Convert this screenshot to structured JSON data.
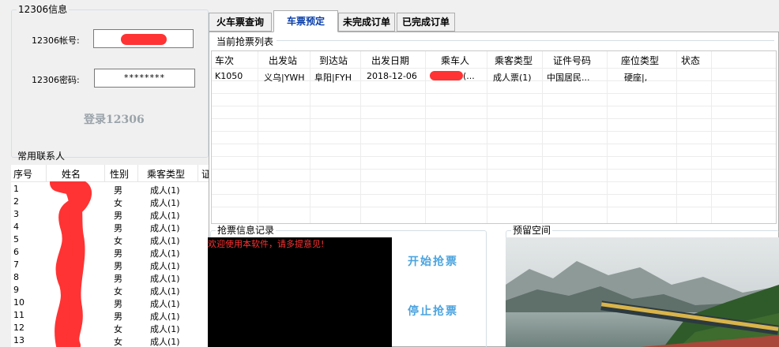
{
  "login": {
    "group_title": "12306信息",
    "account_label": "12306帐号:",
    "password_label": "12306密码:",
    "password_value": "********",
    "login_button": "登录12306"
  },
  "contacts": {
    "group_title": "常用联系人",
    "headers": [
      "序号",
      "姓名",
      "性别",
      "乘客类型",
      "证"
    ],
    "rows": [
      {
        "no": "1",
        "gender": "男",
        "type": "成人(1)"
      },
      {
        "no": "2",
        "gender": "女",
        "type": "成人(1)"
      },
      {
        "no": "3",
        "gender": "男",
        "type": "成人(1)"
      },
      {
        "no": "4",
        "gender": "男",
        "type": "成人(1)"
      },
      {
        "no": "5",
        "gender": "女",
        "type": "成人(1)"
      },
      {
        "no": "6",
        "gender": "男",
        "type": "成人(1)"
      },
      {
        "no": "7",
        "gender": "男",
        "type": "成人(1)"
      },
      {
        "no": "8",
        "gender": "男",
        "type": "成人(1)"
      },
      {
        "no": "9",
        "gender": "女",
        "type": "成人(1)"
      },
      {
        "no": "10",
        "gender": "男",
        "type": "成人(1)"
      },
      {
        "no": "11",
        "gender": "男",
        "type": "成人(1)"
      },
      {
        "no": "12",
        "gender": "女",
        "type": "成人(1)"
      },
      {
        "no": "13",
        "gender": "女",
        "type": "成人(1)"
      }
    ]
  },
  "tabs": [
    "火车票查询",
    "车票预定",
    "未完成订单",
    "已完成订单"
  ],
  "tickets": {
    "group_title": "当前抢票列表",
    "headers": [
      "车次",
      "出发站",
      "到达站",
      "出发日期",
      "乘车人",
      "乘客类型",
      "证件号码",
      "座位类型",
      "状态"
    ],
    "row": {
      "train": "K1050",
      "from": "义乌|YWH",
      "to": "阜阳|FYH",
      "date": "2018-12-06",
      "passenger": "(...",
      "ptype": "成人票(1)",
      "id": "中国居民...",
      "seat": "硬座|,",
      "status": ""
    }
  },
  "log": {
    "group_title": "抢票信息记录",
    "message": "欢迎使用本软件，请多提意见!",
    "start_button": "开始抢票",
    "stop_button": "停止抢票"
  },
  "reserved": {
    "group_title": "预留空间"
  },
  "colors": {
    "accent_blue": "#4aa3df",
    "tab_active_text": "#0a3ea8",
    "redact_red": "#ff3333",
    "log_text": "#ff3333"
  }
}
